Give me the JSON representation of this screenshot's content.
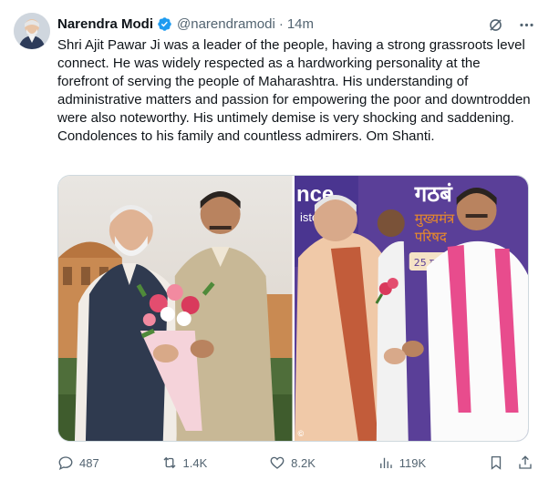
{
  "author": {
    "name": "Narendra Modi",
    "handle": "@narendramodi",
    "time": "14m"
  },
  "tweet_text": "Shri Ajit Pawar Ji was a leader of the people, having a strong grassroots level connect. He was widely respected as a hardworking personality at the forefront of serving the people of Maharashtra. His understanding of administrative matters and passion for empowering the poor and downtrodden were also noteworthy. His untimely demise is very shocking and saddening. Condolences to his family and countless admirers. Om Shanti.",
  "media": {
    "right_banner_text_1": "nce",
    "right_banner_text_2": "ister",
    "right_banner_hindi_1": "गठबं",
    "right_banner_hindi_2": "मुख्यमंत्र",
    "right_banner_hindi_3": "परिषद",
    "right_banner_date": "25 मई",
    "right_watermark": "©"
  },
  "actions": {
    "replies": "487",
    "reposts": "1.4K",
    "likes": "8.2K",
    "views": "119K"
  },
  "icons": [
    "verified-badge-icon",
    "grok-icon",
    "more-icon",
    "reply-icon",
    "repost-icon",
    "like-icon",
    "views-icon",
    "bookmark-icon",
    "share-icon"
  ],
  "colors": {
    "verified": "#1d9bf0",
    "secondary_text": "#536471",
    "banner_purple": "#5a3f98",
    "banner_orange": "#e88a2a"
  }
}
